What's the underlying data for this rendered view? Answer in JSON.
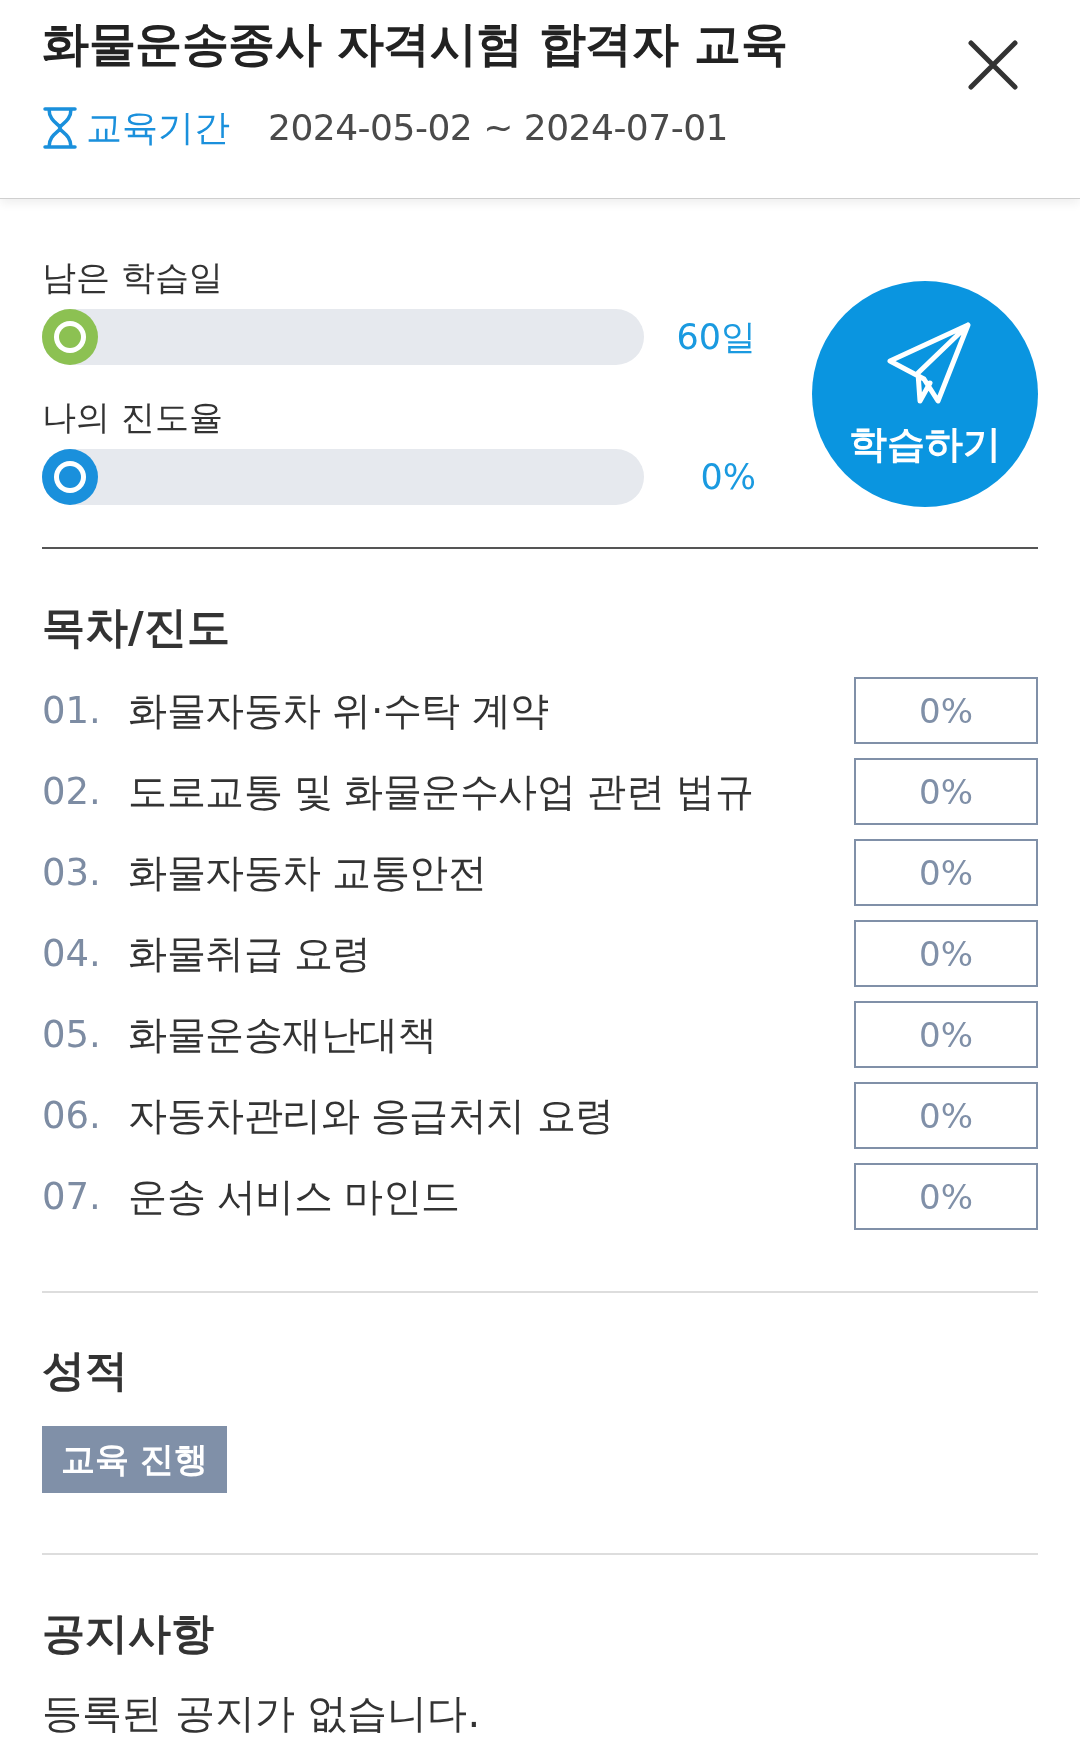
{
  "header": {
    "title": "화물운송종사 자격시험 합격자 교육",
    "period_label": "교육기간",
    "period": "2024-05-02 ~ 2024-07-01"
  },
  "progress": [
    {
      "label": "남은 학습일",
      "level": 0,
      "color": "#8cc152",
      "reading": "60일"
    },
    {
      "label": "나의 진도율",
      "level": 0,
      "color": "#1a90dc",
      "reading": "0%"
    }
  ],
  "study_button": {
    "label": "학습하기"
  },
  "toc": {
    "title": "목차/진도",
    "items": [
      {
        "number": "01.",
        "title": "화물자동차 위·수탁 계약",
        "progress": "0%",
        "level": 0
      },
      {
        "number": "02.",
        "title": "도로교통 및 화물운수사업 관련 법규",
        "progress": "0%",
        "level": 0
      },
      {
        "number": "03.",
        "title": "화물자동차 교통안전",
        "progress": "0%",
        "level": 0
      },
      {
        "number": "04.",
        "title": "화물취급 요령",
        "progress": "0%",
        "level": 0
      },
      {
        "number": "05.",
        "title": "화물운송재난대책",
        "progress": "0%",
        "level": 0
      },
      {
        "number": "06.",
        "title": "자동차관리와 응급처치 요령",
        "progress": "0%",
        "level": 0
      },
      {
        "number": "07.",
        "title": "운송 서비스 마인드",
        "progress": "0%",
        "level": 0
      }
    ]
  },
  "grades": {
    "title": "성적",
    "status": "교육 진행"
  },
  "notices": {
    "title": "공지사항",
    "empty_message": "등록된 공지가 없습니다."
  }
}
